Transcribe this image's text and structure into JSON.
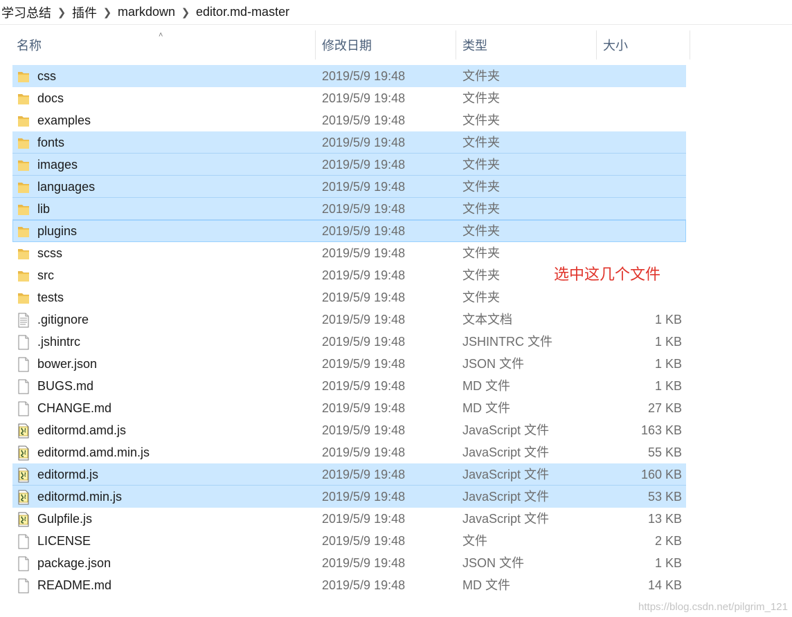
{
  "breadcrumb": [
    "学习总结",
    "插件",
    "markdown",
    "editor.md-master"
  ],
  "columns": {
    "name": "名称",
    "date": "修改日期",
    "type": "类型",
    "size": "大小"
  },
  "files": [
    {
      "name": "css",
      "date": "2019/5/9 19:48",
      "type": "文件夹",
      "size": "",
      "icon": "folder-icon",
      "selected": true
    },
    {
      "name": "docs",
      "date": "2019/5/9 19:48",
      "type": "文件夹",
      "size": "",
      "icon": "folder-icon",
      "selected": false
    },
    {
      "name": "examples",
      "date": "2019/5/9 19:48",
      "type": "文件夹",
      "size": "",
      "icon": "folder-icon",
      "selected": false
    },
    {
      "name": "fonts",
      "date": "2019/5/9 19:48",
      "type": "文件夹",
      "size": "",
      "icon": "folder-icon",
      "selected": true
    },
    {
      "name": "images",
      "date": "2019/5/9 19:48",
      "type": "文件夹",
      "size": "",
      "icon": "folder-icon",
      "selected": true
    },
    {
      "name": "languages",
      "date": "2019/5/9 19:48",
      "type": "文件夹",
      "size": "",
      "icon": "folder-icon",
      "selected": true
    },
    {
      "name": "lib",
      "date": "2019/5/9 19:48",
      "type": "文件夹",
      "size": "",
      "icon": "folder-icon",
      "selected": true
    },
    {
      "name": "plugins",
      "date": "2019/5/9 19:48",
      "type": "文件夹",
      "size": "",
      "icon": "folder-icon",
      "selected": true,
      "focused": true
    },
    {
      "name": "scss",
      "date": "2019/5/9 19:48",
      "type": "文件夹",
      "size": "",
      "icon": "folder-icon",
      "selected": false
    },
    {
      "name": "src",
      "date": "2019/5/9 19:48",
      "type": "文件夹",
      "size": "",
      "icon": "folder-icon",
      "selected": false
    },
    {
      "name": "tests",
      "date": "2019/5/9 19:48",
      "type": "文件夹",
      "size": "",
      "icon": "folder-icon",
      "selected": false
    },
    {
      "name": ".gitignore",
      "date": "2019/5/9 19:48",
      "type": "文本文档",
      "size": "1 KB",
      "icon": "text-document-icon",
      "selected": false
    },
    {
      "name": ".jshintrc",
      "date": "2019/5/9 19:48",
      "type": "JSHINTRC 文件",
      "size": "1 KB",
      "icon": "file-icon",
      "selected": false
    },
    {
      "name": "bower.json",
      "date": "2019/5/9 19:48",
      "type": "JSON 文件",
      "size": "1 KB",
      "icon": "file-icon",
      "selected": false
    },
    {
      "name": "BUGS.md",
      "date": "2019/5/9 19:48",
      "type": "MD 文件",
      "size": "1 KB",
      "icon": "file-icon",
      "selected": false
    },
    {
      "name": "CHANGE.md",
      "date": "2019/5/9 19:48",
      "type": "MD 文件",
      "size": "27 KB",
      "icon": "file-icon",
      "selected": false
    },
    {
      "name": "editormd.amd.js",
      "date": "2019/5/9 19:48",
      "type": "JavaScript 文件",
      "size": "163 KB",
      "icon": "script-file-icon",
      "selected": false
    },
    {
      "name": "editormd.amd.min.js",
      "date": "2019/5/9 19:48",
      "type": "JavaScript 文件",
      "size": "55 KB",
      "icon": "script-file-icon",
      "selected": false
    },
    {
      "name": "editormd.js",
      "date": "2019/5/9 19:48",
      "type": "JavaScript 文件",
      "size": "160 KB",
      "icon": "script-file-icon",
      "selected": true
    },
    {
      "name": "editormd.min.js",
      "date": "2019/5/9 19:48",
      "type": "JavaScript 文件",
      "size": "53 KB",
      "icon": "script-file-icon",
      "selected": true
    },
    {
      "name": "Gulpfile.js",
      "date": "2019/5/9 19:48",
      "type": "JavaScript 文件",
      "size": "13 KB",
      "icon": "script-file-icon",
      "selected": false
    },
    {
      "name": "LICENSE",
      "date": "2019/5/9 19:48",
      "type": "文件",
      "size": "2 KB",
      "icon": "file-icon",
      "selected": false
    },
    {
      "name": "package.json",
      "date": "2019/5/9 19:48",
      "type": "JSON 文件",
      "size": "1 KB",
      "icon": "file-icon",
      "selected": false
    },
    {
      "name": "README.md",
      "date": "2019/5/9 19:48",
      "type": "MD 文件",
      "size": "14 KB",
      "icon": "file-icon",
      "selected": false
    }
  ],
  "annotation": "选中这几个文件",
  "watermark": "https://blog.csdn.net/pilgrim_121",
  "colors": {
    "selection": "#cce8ff",
    "selection_border": "#99d1ff",
    "annotation": "#e0342b",
    "folder": "#f8d775",
    "header_text": "#4c607a"
  }
}
